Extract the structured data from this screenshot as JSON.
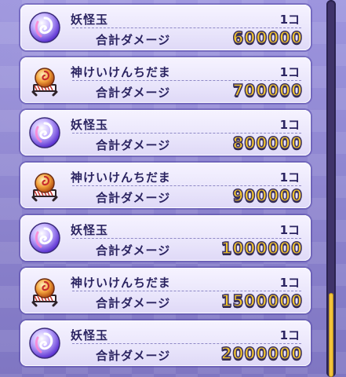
{
  "items": [
    {
      "name": "妖怪玉",
      "qty": "1コ",
      "label": "合計ダメージ",
      "value": "600000",
      "icon": "yokai-orb-icon"
    },
    {
      "name": "神けいけんちだま",
      "qty": "1コ",
      "label": "合計ダメージ",
      "value": "700000",
      "icon": "god-exp-orb-icon"
    },
    {
      "name": "妖怪玉",
      "qty": "1コ",
      "label": "合計ダメージ",
      "value": "800000",
      "icon": "yokai-orb-icon"
    },
    {
      "name": "神けいけんちだま",
      "qty": "1コ",
      "label": "合計ダメージ",
      "value": "900000",
      "icon": "god-exp-orb-icon"
    },
    {
      "name": "妖怪玉",
      "qty": "1コ",
      "label": "合計ダメージ",
      "value": "1000000",
      "icon": "yokai-orb-icon"
    },
    {
      "name": "神けいけんちだま",
      "qty": "1コ",
      "label": "合計ダメージ",
      "value": "1500000",
      "icon": "god-exp-orb-icon"
    },
    {
      "name": "妖怪玉",
      "qty": "1コ",
      "label": "合計ダメージ",
      "value": "2000000",
      "icon": "yokai-orb-icon"
    }
  ],
  "colors": {
    "value_fill": "#f4c72c",
    "text": "#2b2461",
    "scroll_thumb": "#f3c43a"
  }
}
